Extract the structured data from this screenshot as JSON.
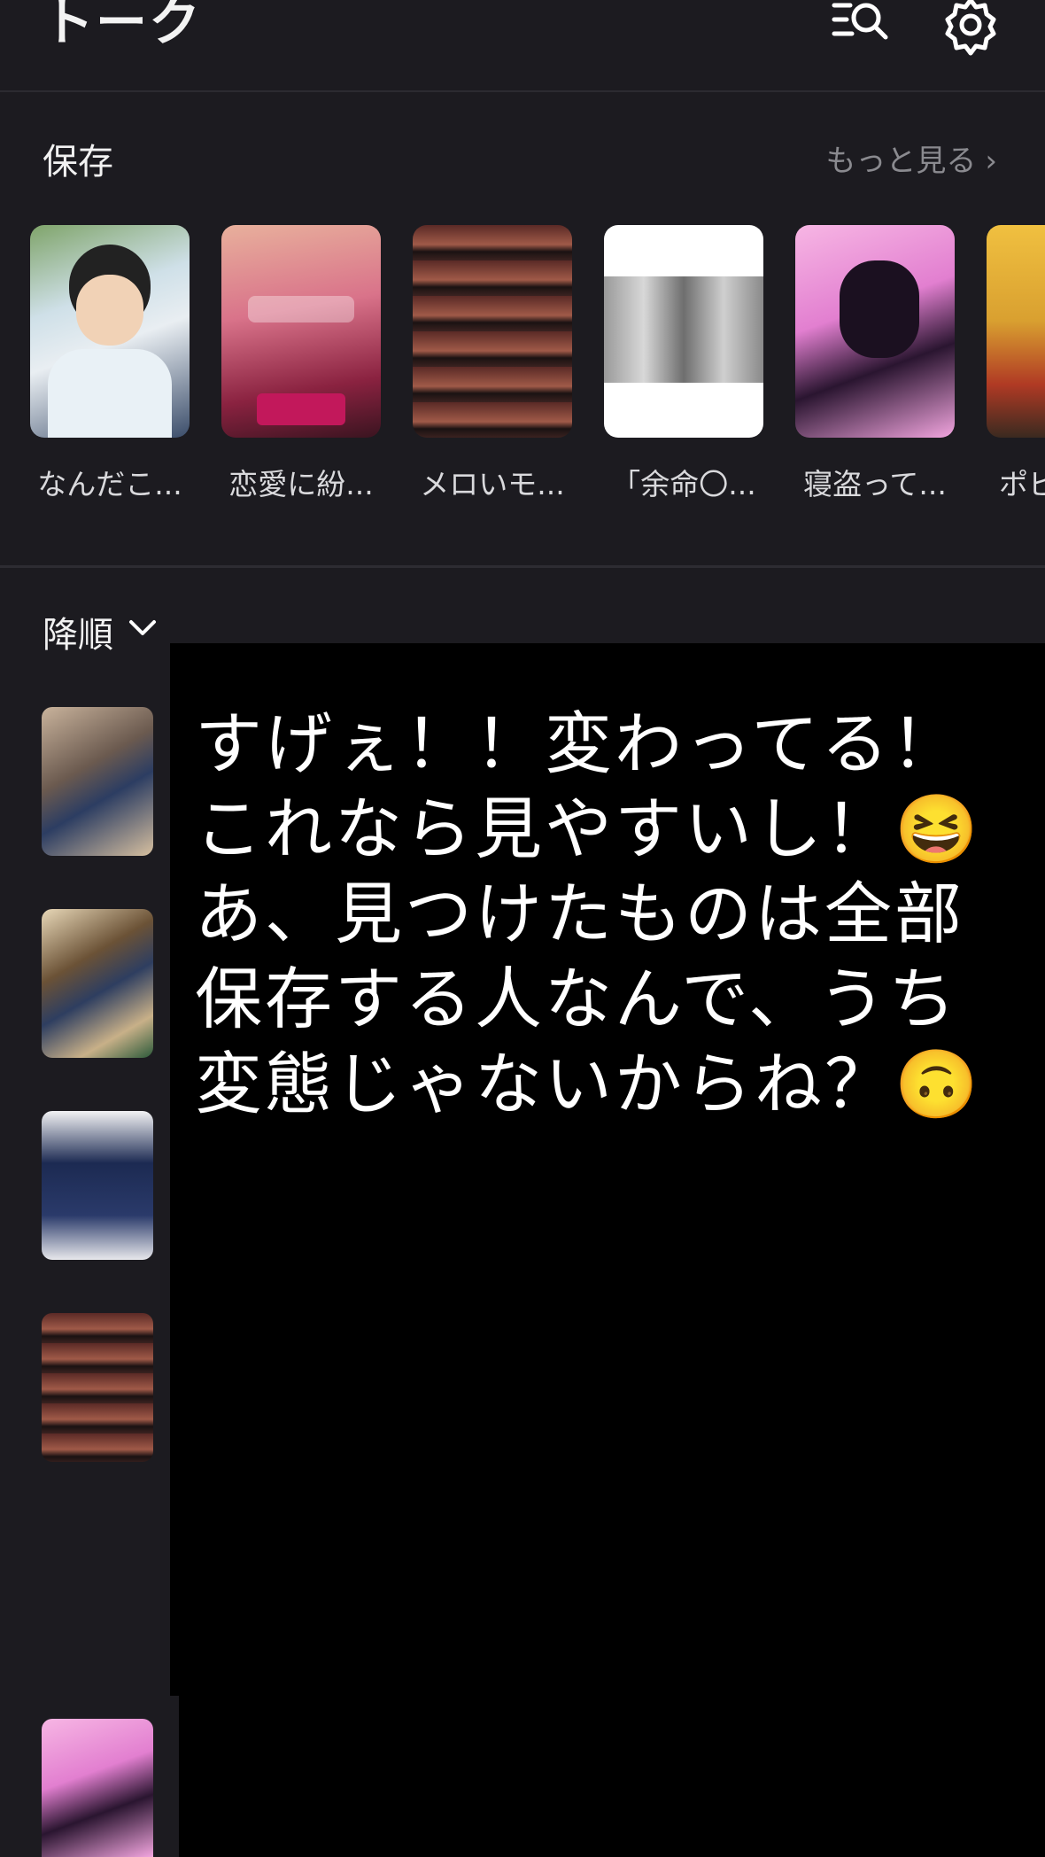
{
  "header": {
    "title": "トーク",
    "search_icon": "search-list-icon",
    "settings_icon": "gear-icon"
  },
  "saved": {
    "title": "保存",
    "more_label": "もっと見る",
    "more_icon": "chevron-right-icon",
    "items": [
      {
        "label": "なんだこ..."
      },
      {
        "label": "恋愛に紛..."
      },
      {
        "label": "メロいモ..."
      },
      {
        "label": "「余命〇..."
      },
      {
        "label": "寝盗って..."
      },
      {
        "label": "ポビ"
      }
    ]
  },
  "list": {
    "sort_label": "降順",
    "sort_icon": "chevron-down-icon"
  },
  "overlay": {
    "lines": [
      "すげぇ！！変わってる！",
      "これなら見やすいし！😆",
      "あ、見つけたものは全部",
      "保存する人なんで、うち",
      "変態じゃないからね？🙃"
    ]
  },
  "colors": {
    "background": "#1c1b20",
    "overlay": "#000000",
    "muted": "#8a8a8f"
  }
}
